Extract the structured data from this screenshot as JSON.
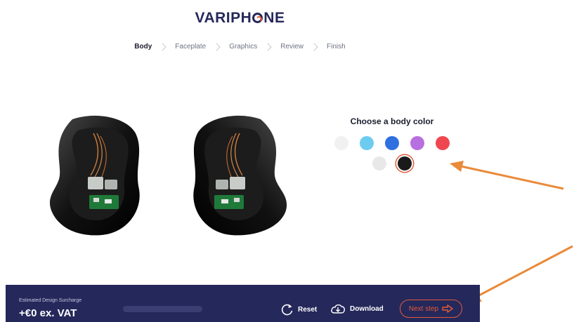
{
  "brand": {
    "logo_pre": "VARIPH",
    "logo_post": "NE"
  },
  "steps": [
    {
      "label": "Body",
      "active": true
    },
    {
      "label": "Faceplate",
      "active": false
    },
    {
      "label": "Graphics",
      "active": false
    },
    {
      "label": "Review",
      "active": false
    },
    {
      "label": "Finish",
      "active": false
    }
  ],
  "color_panel": {
    "title": "Choose a body color",
    "row1": [
      {
        "name": "white",
        "hex": "#f1f1f1"
      },
      {
        "name": "light-blue",
        "hex": "#6ecbf0"
      },
      {
        "name": "blue",
        "hex": "#2f6fe0"
      },
      {
        "name": "purple",
        "hex": "#b86fe0"
      },
      {
        "name": "red",
        "hex": "#f04650"
      }
    ],
    "row2": [
      {
        "name": "light-grey",
        "hex": "#e8e8e8"
      },
      {
        "name": "black",
        "hex": "#1a1a1a",
        "selected": true
      }
    ]
  },
  "bottom_bar": {
    "surcharge_label": "Estimated Design Surcharge",
    "surcharge_value": "+€0 ex. VAT",
    "reset_label": "Reset",
    "download_label": "Download",
    "next_label": "Next step"
  },
  "colors": {
    "brand": "#25285a",
    "accent": "#e35a3c",
    "annotation_arrow": "#ea8a3a"
  }
}
